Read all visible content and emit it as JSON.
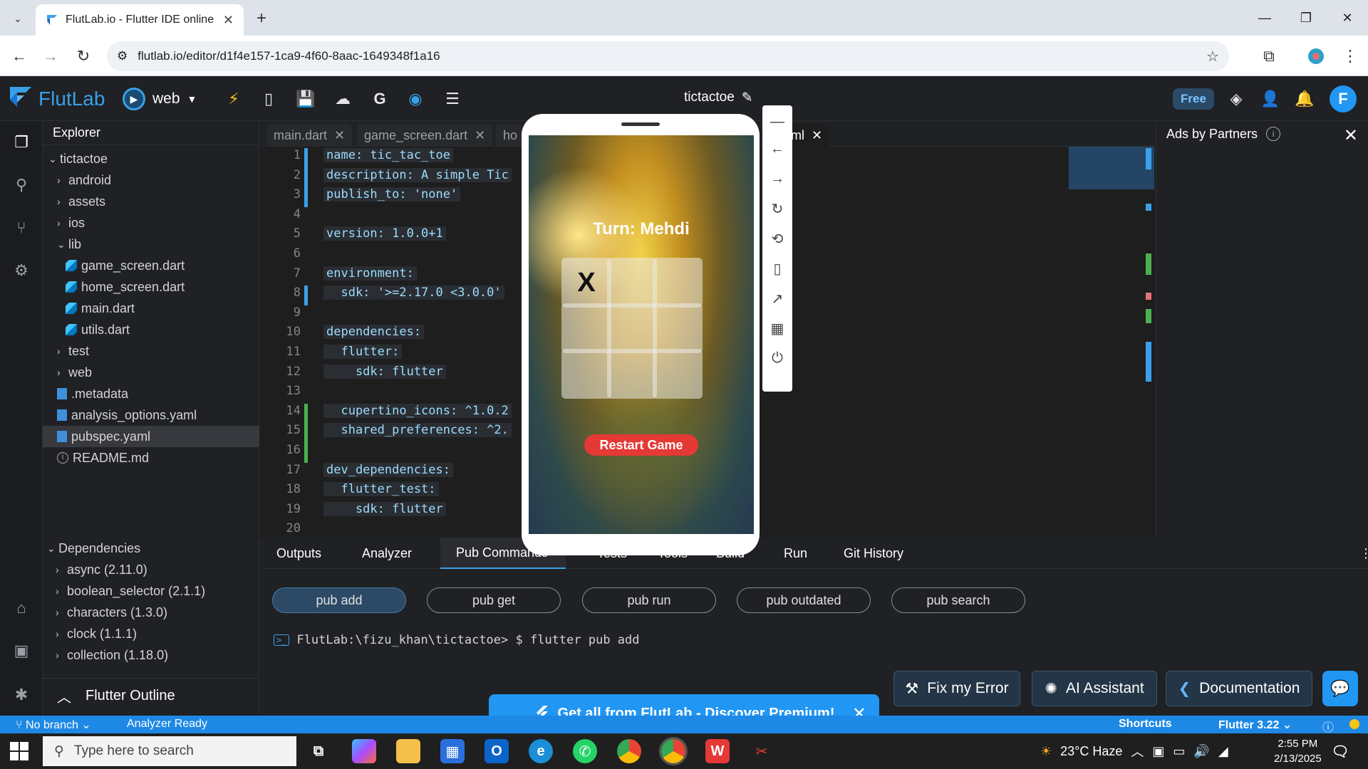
{
  "browser": {
    "tab_title": "FlutLab.io - Flutter IDE online",
    "url": "flutlab.io/editor/d1f4e157-1ca9-4f60-8aac-1649348f1a16"
  },
  "header": {
    "logo": "FlutLab",
    "target": "web",
    "project": "tictactoe",
    "free_badge": "Free",
    "avatar_letter": "F"
  },
  "explorer": {
    "title": "Explorer",
    "items": [
      {
        "label": "tictactoe",
        "type": "folder-open"
      },
      {
        "label": "android",
        "type": "folder"
      },
      {
        "label": "assets",
        "type": "folder"
      },
      {
        "label": "ios",
        "type": "folder"
      },
      {
        "label": "lib",
        "type": "folder-open"
      },
      {
        "label": "game_screen.dart",
        "type": "dart"
      },
      {
        "label": "home_screen.dart",
        "type": "dart"
      },
      {
        "label": "main.dart",
        "type": "dart"
      },
      {
        "label": "utils.dart",
        "type": "dart"
      },
      {
        "label": "test",
        "type": "folder"
      },
      {
        "label": "web",
        "type": "folder"
      },
      {
        "label": ".metadata",
        "type": "file"
      },
      {
        "label": "analysis_options.yaml",
        "type": "file"
      },
      {
        "label": "pubspec.yaml",
        "type": "file",
        "selected": true
      },
      {
        "label": "README.md",
        "type": "info"
      }
    ]
  },
  "dependencies": {
    "title": "Dependencies",
    "items": [
      "async (2.11.0)",
      "boolean_selector (2.1.1)",
      "characters (1.3.0)",
      "clock (1.1.1)",
      "collection (1.18.0)"
    ]
  },
  "outline": {
    "title": "Flutter Outline"
  },
  "editor_tabs": [
    "main.dart",
    "game_screen.dart",
    "ho",
    "ml"
  ],
  "code": {
    "line_numbers": [
      "1",
      "2",
      "3",
      "4",
      "5",
      "6",
      "7",
      "8",
      "9",
      "10",
      "11",
      "12",
      "13",
      "14",
      "15",
      "16",
      "17",
      "18",
      "19",
      "20"
    ],
    "lines": [
      "name: tic_tac_toe",
      "description: A simple Tic",
      "publish_to: 'none'",
      "",
      "version: 1.0.0+1",
      "",
      "environment:",
      "  sdk: '>=2.17.0 <3.0.0'",
      "",
      "dependencies:",
      "  flutter:",
      "    sdk: flutter",
      "",
      "  cupertino_icons: ^1.0.2",
      "  shared_preferences: ^2.",
      "",
      "dev_dependencies:",
      "  flutter_test:",
      "    sdk: flutter",
      ""
    ]
  },
  "ads": {
    "title": "Ads by Partners"
  },
  "bottom_tabs": [
    "Outputs",
    "Analyzer",
    "Pub Commands",
    "Tests",
    "Tools",
    "Build",
    "Run",
    "Git History"
  ],
  "pub_buttons": [
    "pub add",
    "pub get",
    "pub run",
    "pub outdated",
    "pub search"
  ],
  "terminal": {
    "prompt": "FlutLab:\\fizu_khan\\tictactoe> $ flutter pub add"
  },
  "actions": {
    "fix": "Fix my Error",
    "ai": "AI Assistant",
    "docs": "Documentation"
  },
  "promo": {
    "text": "Get all from FlutLab - Discover Premium!"
  },
  "status": {
    "branch": "No branch",
    "analyzer": "Analyzer Ready",
    "shortcuts": "Shortcuts",
    "flutter": "Flutter 3.22"
  },
  "device": {
    "turn": "Turn: Mehdi",
    "cells": [
      "X",
      "",
      "",
      "",
      "",
      "",
      "",
      "",
      ""
    ],
    "restart": "Restart Game"
  },
  "taskbar": {
    "search_placeholder": "Type here to search",
    "weather": "23°C  Haze",
    "time": "2:55 PM",
    "date": "2/13/2025"
  }
}
